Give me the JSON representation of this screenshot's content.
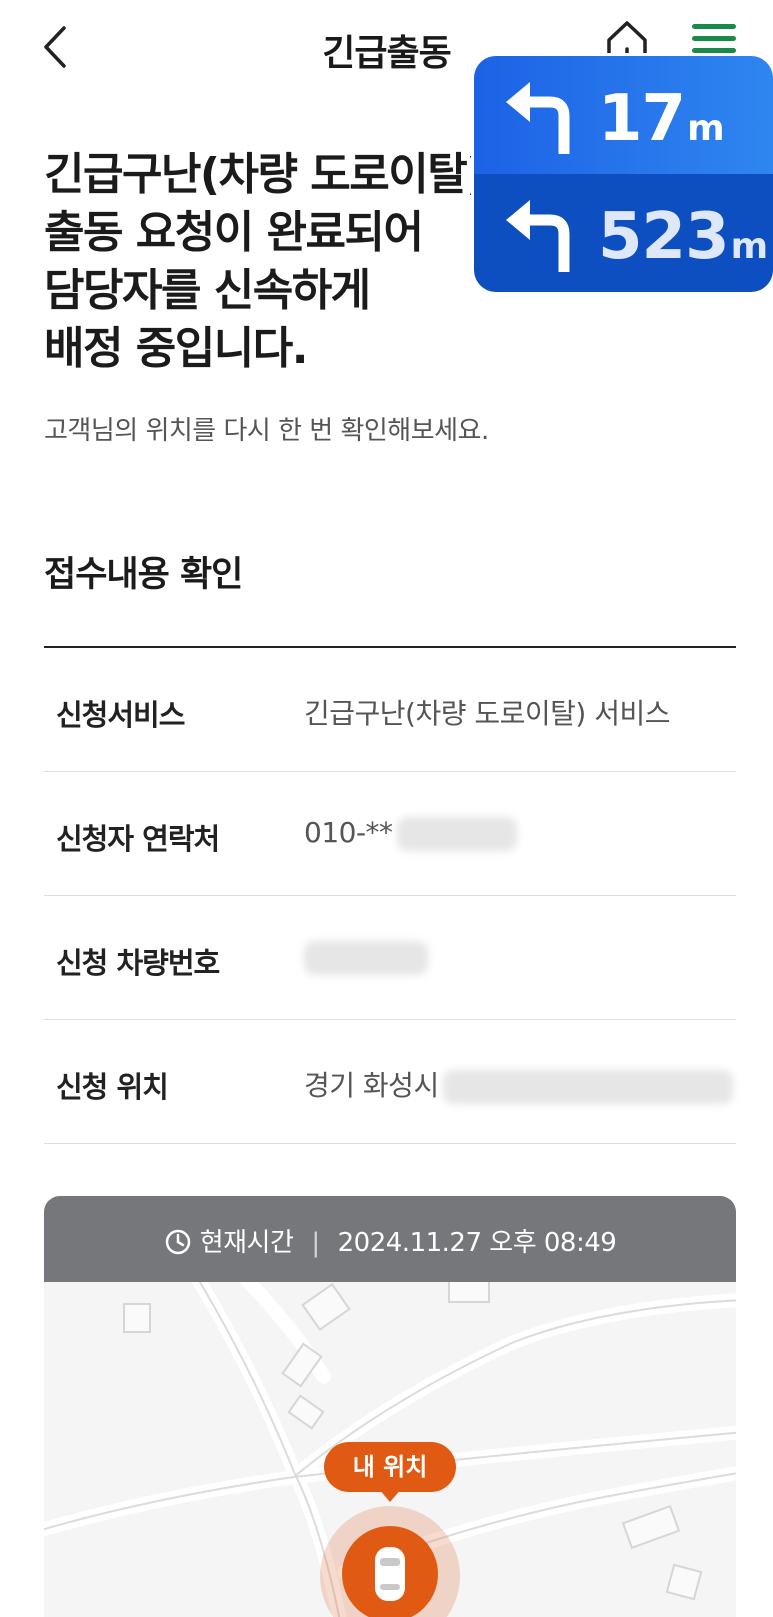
{
  "header": {
    "title": "긴급출동"
  },
  "navigation_overlay": {
    "turns": [
      {
        "direction": "left",
        "distance": "17",
        "unit": "m"
      },
      {
        "direction": "left",
        "distance": "523",
        "unit": "m"
      }
    ]
  },
  "main": {
    "headline": [
      "긴급구난(차량 도로이탈)",
      "출동 요청이 완료되어",
      "담당자를 신속하게",
      "배정 중입니다."
    ],
    "subtext": "고객님의 위치를 다시 한 번 확인해보세요.",
    "section_title": "접수내용 확인",
    "rows": [
      {
        "label": "신청서비스",
        "value": "긴급구난(차량 도로이탈) 서비스"
      },
      {
        "label": "신청자 연락처",
        "value": "010-**"
      },
      {
        "label": "신청 차량번호",
        "value": ""
      },
      {
        "label": "신청 위치",
        "value": "경기 화성시"
      }
    ]
  },
  "map": {
    "time_label": "현재시간",
    "separator": "|",
    "time_value": "2024.11.27 오후 08:49",
    "my_location_label": "내 위치"
  },
  "colors": {
    "accent_orange": "#e15a14",
    "nav_blue": "#1d62e5",
    "menu_green": "#1a8a4a",
    "map_bar_gray": "#76777a"
  },
  "icons": {
    "back": "chevron-left-icon",
    "home": "home-icon",
    "menu": "hamburger-menu-icon",
    "turn": "turn-left-arrow-icon",
    "clock": "clock-icon",
    "car": "car-icon"
  }
}
